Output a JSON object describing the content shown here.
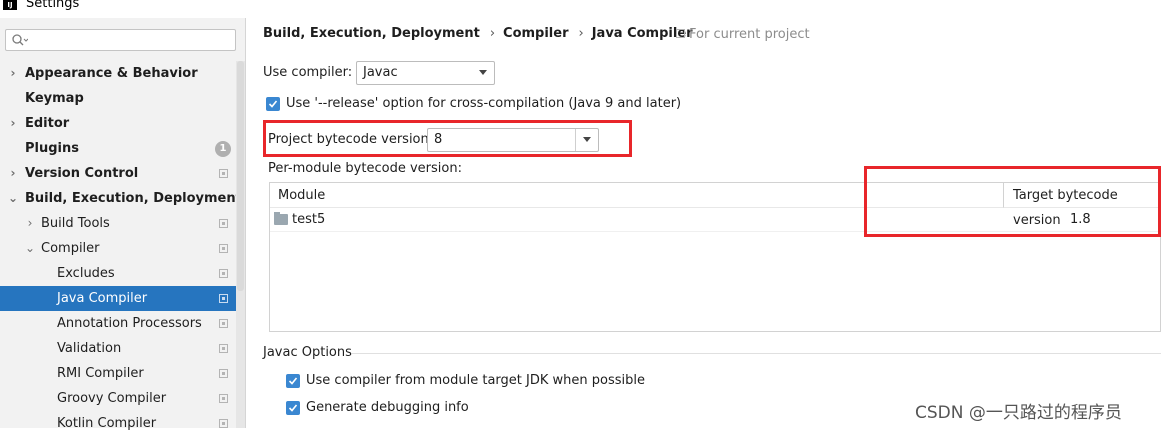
{
  "window": {
    "title": "Settings",
    "app_icon_text": "IJ"
  },
  "sidebar": {
    "search": {
      "value": "",
      "placeholder": ""
    },
    "items": [
      {
        "label": "Appearance & Behavior"
      },
      {
        "label": "Keymap"
      },
      {
        "label": "Editor"
      },
      {
        "label": "Plugins",
        "badge": "1"
      },
      {
        "label": "Version Control"
      },
      {
        "label": "Build, Execution, Deployment"
      },
      {
        "label": "Build Tools"
      },
      {
        "label": "Compiler"
      },
      {
        "label": "Excludes"
      },
      {
        "label": "Java Compiler"
      },
      {
        "label": "Annotation Processors"
      },
      {
        "label": "Validation"
      },
      {
        "label": "RMI Compiler"
      },
      {
        "label": "Groovy Compiler"
      },
      {
        "label": "Kotlin Compiler"
      }
    ]
  },
  "breadcrumb": [
    "Build, Execution, Deployment",
    "Compiler",
    "Java Compiler"
  ],
  "scope_label": "For current project",
  "use_compiler": {
    "label": "Use compiler:",
    "value": "Javac"
  },
  "release_option": {
    "label": "Use '--release' option for cross-compilation (Java 9 and later)",
    "checked": true
  },
  "project_bytecode": {
    "label": "Project bytecode version:",
    "value": "8"
  },
  "per_module": {
    "label": "Per-module bytecode version:",
    "columns": [
      "Module",
      "Target bytecode version"
    ],
    "rows": [
      {
        "module": "test5",
        "version": "1.8"
      }
    ]
  },
  "javac_options": {
    "title": "Javac Options",
    "module_jdk": {
      "label": "Use compiler from module target JDK when possible",
      "checked": true
    },
    "debug_info": {
      "label": "Generate debugging info",
      "checked": true
    }
  },
  "watermark": "CSDN @一只路过的程序员",
  "colors": {
    "selection": "#2675bf",
    "checkbox": "#3a87d1",
    "highlight": "#e8262a"
  }
}
